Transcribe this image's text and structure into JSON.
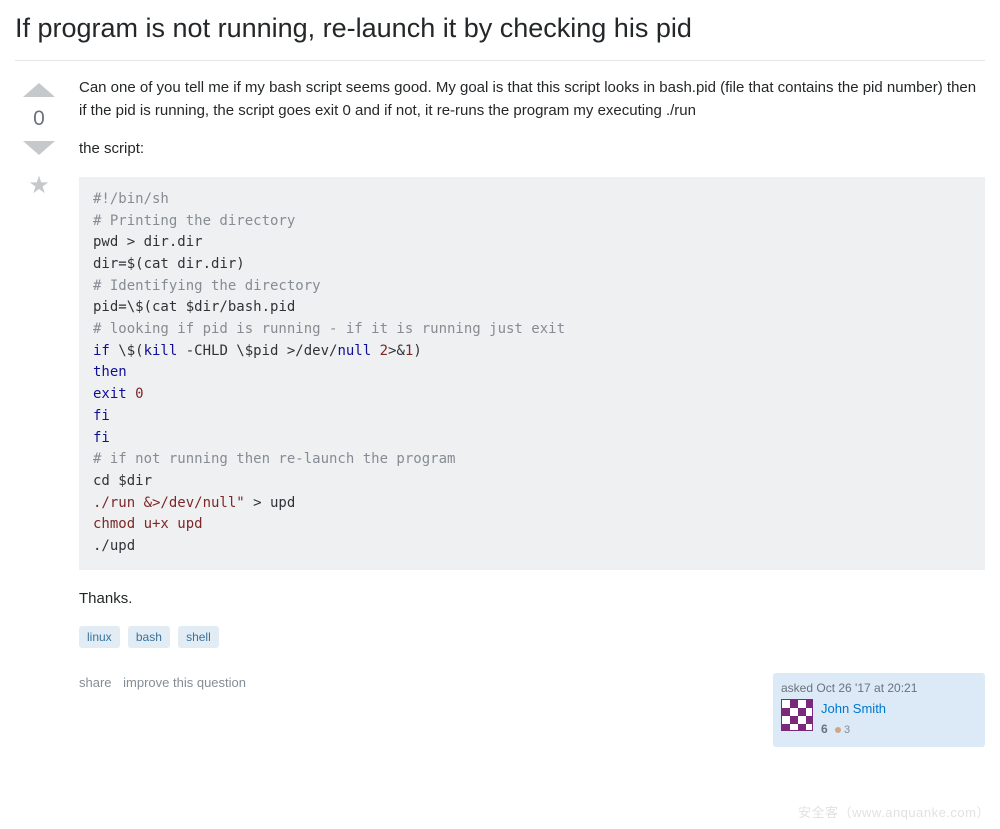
{
  "question": {
    "title": "If program is not running, re-launch it by checking his pid",
    "body_p1": "Can one of you tell me if my bash script seems good. My goal is that this script looks in bash.pid (file that contains the pid number) then if the pid is running, the script goes exit 0 and if not, it re-runs the program my executing ./run",
    "body_p2": "the script:",
    "body_p3": "Thanks.",
    "code": {
      "l1": "#!/bin/sh",
      "l2": "# Printing the directory",
      "l3a": "pwd > dir",
      "l3b": ".",
      "l3c": "dir",
      "l4a": "dir=$(cat dir",
      "l4b": ".",
      "l4c": "dir)",
      "l5": "# Identifying the directory",
      "l6a": "pid=\\$(cat $dir/bash",
      "l6b": ".",
      "l6c": "pid",
      "l7": "# looking if pid is running - if it is running just exit",
      "l8a": "if",
      "l8b": " \\$(",
      "l8c": "kill",
      "l8d": " -CHLD \\$pid >/dev/",
      "l8e": "null",
      "l8f": " ",
      "l8g": "2",
      "l8h": ">&",
      "l8i": "1",
      "l8j": ")",
      "l9": "then",
      "l10a": "exit",
      "l10b": " ",
      "l10c": "0",
      "l11": "fi",
      "l12": "fi",
      "l13": "# if not running then re-launch the program",
      "l14": "cd $dir",
      "l15a": "./run &>/dev/null\"",
      "l15b": " > upd",
      "l16": "chmod u+x upd",
      "l17": "./upd"
    },
    "tags": [
      "linux",
      "bash",
      "shell"
    ],
    "vote_count": "0"
  },
  "post_menu": {
    "share": "share",
    "improve": "improve this question"
  },
  "user_card": {
    "action": "asked",
    "time": "Oct 26 '17 at 20:21",
    "name": "John Smith",
    "reputation": "6",
    "bronze_count": "3"
  },
  "watermark": "安全客（www.anquanke.com）"
}
